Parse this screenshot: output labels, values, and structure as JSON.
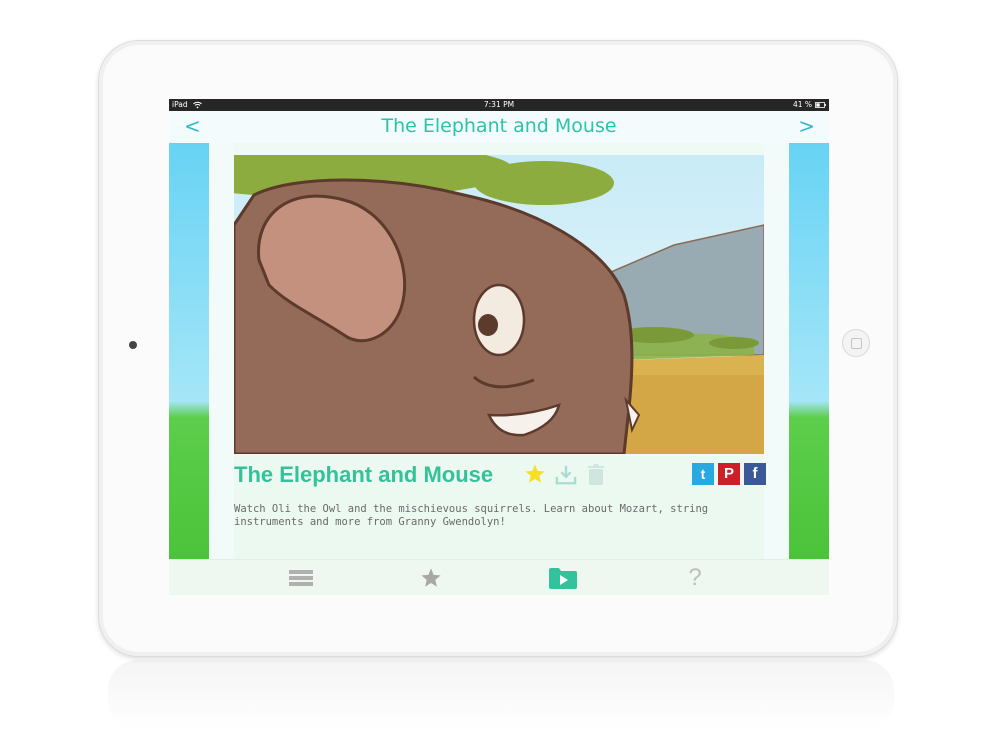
{
  "status_bar": {
    "carrier": "iPad",
    "time": "7:31 PM",
    "battery": "41 %"
  },
  "nav": {
    "back": "<",
    "title": "The Elephant and Mouse",
    "forward": ">"
  },
  "episode": {
    "title": "The Elephant and Mouse",
    "description": "Watch Oli the Owl and the mischievous squirrels. Learn about Mozart, string instruments and more from Granny Gwendolyn!"
  },
  "social": {
    "twitter": "t",
    "pinterest": "P",
    "facebook": "f"
  },
  "tabbar": {
    "help": "?"
  },
  "colors": {
    "accent": "#2dc3a8",
    "nav_arrow": "#2fb8d2",
    "favorite": "#f5e025",
    "icon_inactive": "#b0b0b0",
    "tab_active": "#33c29b"
  },
  "icons": {
    "nav_back": "chevron-left-icon",
    "nav_forward": "chevron-right-icon",
    "favorite": "star-icon",
    "download": "download-icon",
    "delete": "trash-icon",
    "twitter": "twitter-icon",
    "pinterest": "pinterest-icon",
    "facebook": "facebook-icon",
    "tab_list": "list-icon",
    "tab_favorites": "star-icon",
    "tab_videos": "play-folder-icon",
    "tab_help": "question-icon"
  }
}
